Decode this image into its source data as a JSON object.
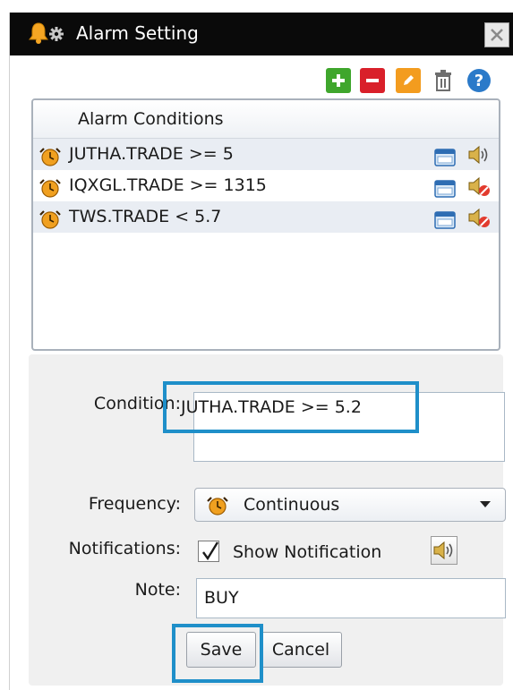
{
  "window": {
    "title": "Alarm Setting"
  },
  "toolbar": {
    "add": "add-icon",
    "remove": "remove-icon",
    "edit": "edit-icon",
    "delete": "trash-icon",
    "help": "help-icon"
  },
  "conditions": {
    "header": "Alarm Conditions",
    "rows": [
      {
        "text": "JUTHA.TRADE >= 5",
        "sound": "on"
      },
      {
        "text": "IQXGL.TRADE >= 1315",
        "sound": "muted"
      },
      {
        "text": "TWS.TRADE < 5.7",
        "sound": "muted"
      }
    ]
  },
  "form": {
    "condition_label": "Condition:",
    "condition_value": "JUTHA.TRADE >= 5.2",
    "frequency_label": "Frequency:",
    "frequency_value": "Continuous",
    "notifications_label": "Notifications:",
    "show_notification_label": "Show Notification",
    "show_notification_checked": true,
    "note_label": "Note:",
    "note_value": "BUY",
    "save_label": "Save",
    "cancel_label": "Cancel"
  },
  "colors": {
    "titlebar": "#0a0a0a",
    "highlight": "#1f8fc9",
    "add": "#3fa62c",
    "remove": "#d9202a",
    "edit": "#f39c1f"
  }
}
